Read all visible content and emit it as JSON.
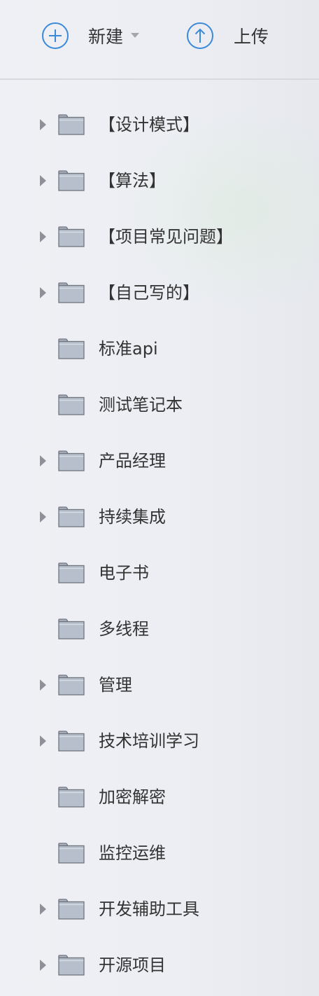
{
  "toolbar": {
    "new_label": "新建",
    "upload_label": "上传",
    "new_icon": "plus-circle-icon",
    "upload_icon": "upload-arrow-icon",
    "accent_color": "#3b8ad9"
  },
  "tree": {
    "items": [
      {
        "label": "【设计模式】",
        "expandable": true
      },
      {
        "label": "【算法】",
        "expandable": true
      },
      {
        "label": "【项目常见问题】",
        "expandable": true
      },
      {
        "label": "【自己写的】",
        "expandable": true
      },
      {
        "label": "标准api",
        "expandable": false
      },
      {
        "label": "测试笔记本",
        "expandable": false
      },
      {
        "label": "产品经理",
        "expandable": true
      },
      {
        "label": "持续集成",
        "expandable": true
      },
      {
        "label": "电子书",
        "expandable": false
      },
      {
        "label": "多线程",
        "expandable": false
      },
      {
        "label": "管理",
        "expandable": true
      },
      {
        "label": "技术培训学习",
        "expandable": true
      },
      {
        "label": "加密解密",
        "expandable": false
      },
      {
        "label": "监控运维",
        "expandable": false
      },
      {
        "label": "开发辅助工具",
        "expandable": true
      },
      {
        "label": "开源项目",
        "expandable": true
      }
    ]
  }
}
